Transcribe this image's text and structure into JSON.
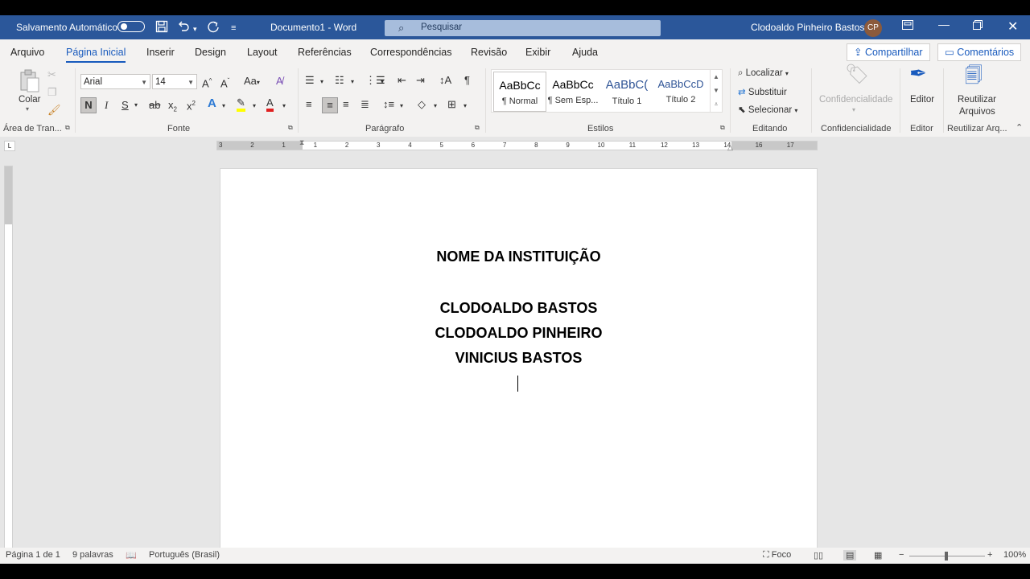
{
  "titlebar": {
    "autosave_label": "Salvamento Automático",
    "doc_title": "Documento1 - Word",
    "search_placeholder": "Pesquisar",
    "user_name": "Clodoaldo Pinheiro Bastos",
    "user_initials": "CP",
    "icons": [
      "save-icon",
      "undo-icon",
      "redo-icon",
      "customize-qat-icon",
      "ribbon-display-icon",
      "minimize-icon",
      "restore-icon",
      "close-icon"
    ]
  },
  "tabs": [
    "Arquivo",
    "Página Inicial",
    "Inserir",
    "Design",
    "Layout",
    "Referências",
    "Correspondências",
    "Revisão",
    "Exibir",
    "Ajuda"
  ],
  "active_tab": "Página Inicial",
  "share_label": "Compartilhar",
  "comments_label": "Comentários",
  "ribbon": {
    "clipboard": {
      "paste_label": "Colar",
      "group_label": "Área de Tran..."
    },
    "font": {
      "font_name": "Arial",
      "font_size": "14",
      "bold": "N",
      "italic": "I",
      "underline": "S",
      "group_label": "Fonte"
    },
    "paragraph": {
      "group_label": "Parágrafo"
    },
    "styles": {
      "items": [
        {
          "preview": "AaBbCc",
          "name": "¶ Normal"
        },
        {
          "preview": "AaBbCc",
          "name": "¶ Sem Esp..."
        },
        {
          "preview": "AaBbC(",
          "name": "Título 1"
        },
        {
          "preview": "AaBbCcD",
          "name": "Título 2"
        }
      ],
      "group_label": "Estilos"
    },
    "editing": {
      "find": "Localizar",
      "replace": "Substituir",
      "select": "Selecionar",
      "group_label": "Editando"
    },
    "confidentiality": {
      "label": "Confidencialidade",
      "group_label": "Confidencialidade"
    },
    "editor": {
      "label": "Editor",
      "group_label": "Editor"
    },
    "reuse": {
      "label_line1": "Reutilizar",
      "label_line2": "Arquivos",
      "group_label": "Reutilizar Arq..."
    }
  },
  "document": {
    "lines": [
      "NOME DA INSTITUIÇÃO",
      "CLODOALDO BASTOS",
      "CLODOALDO PINHEIRO",
      "VINICIUS BASTOS"
    ]
  },
  "ruler": {
    "numbers": [
      "3",
      "2",
      "1",
      "1",
      "2",
      "3",
      "4",
      "5",
      "6",
      "7",
      "8",
      "9",
      "10",
      "11",
      "12",
      "13",
      "14",
      "16",
      "17"
    ]
  },
  "statusbar": {
    "page": "Página 1 de 1",
    "words": "9 palavras",
    "language": "Português (Brasil)",
    "focus": "Foco",
    "zoom": "100%"
  },
  "colors": {
    "title_blue": "#2b579a",
    "accent": "#185abd",
    "ribbon_bg": "#f3f2f1"
  }
}
